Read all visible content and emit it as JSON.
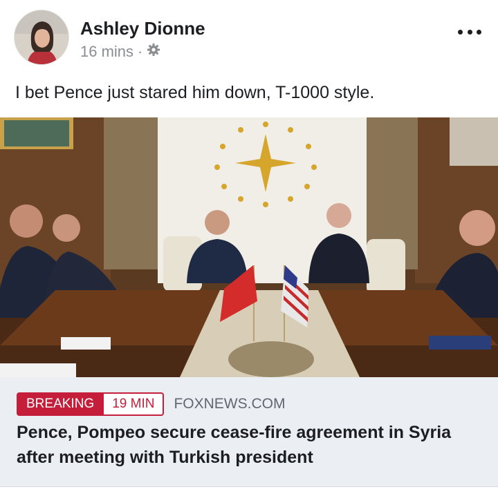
{
  "post": {
    "author": "Ashley Dionne",
    "time": "16 mins",
    "separator": "·",
    "privacy_icon": "gear-icon",
    "text": "I bet Pence just stared him down, T-1000 style."
  },
  "link_preview": {
    "badge_label": "BREAKING",
    "badge_time": "19 MIN",
    "domain": "FOXNEWS.COM",
    "headline": "Pence, Pompeo secure cease-fire agreement in Syria after meeting with Turkish president"
  },
  "colors": {
    "badge_red": "#c41e3a",
    "link_bg": "#ebeef2",
    "meta_gray": "#8a8d91"
  }
}
